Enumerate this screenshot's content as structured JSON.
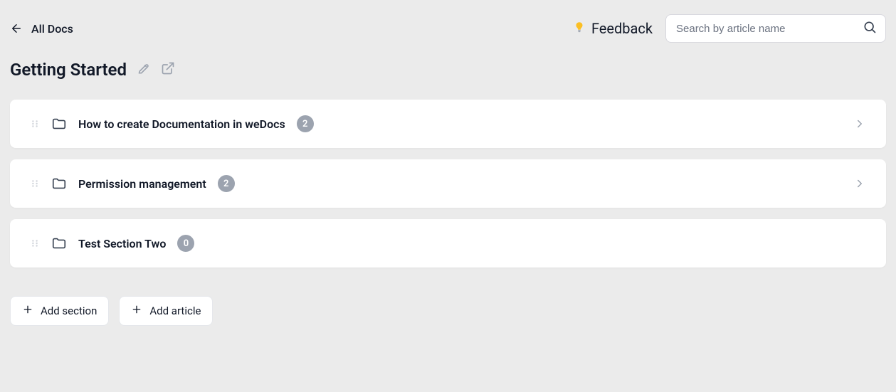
{
  "header": {
    "back_label": "All Docs",
    "feedback_label": "Feedback",
    "search_placeholder": "Search by article name"
  },
  "page": {
    "title": "Getting Started"
  },
  "sections": [
    {
      "title": "How to create Documentation in weDocs",
      "count": "2",
      "expandable": true
    },
    {
      "title": "Permission management",
      "count": "2",
      "expandable": true
    },
    {
      "title": "Test Section Two",
      "count": "0",
      "expandable": false
    }
  ],
  "actions": {
    "add_section_label": "Add section",
    "add_article_label": "Add article"
  }
}
